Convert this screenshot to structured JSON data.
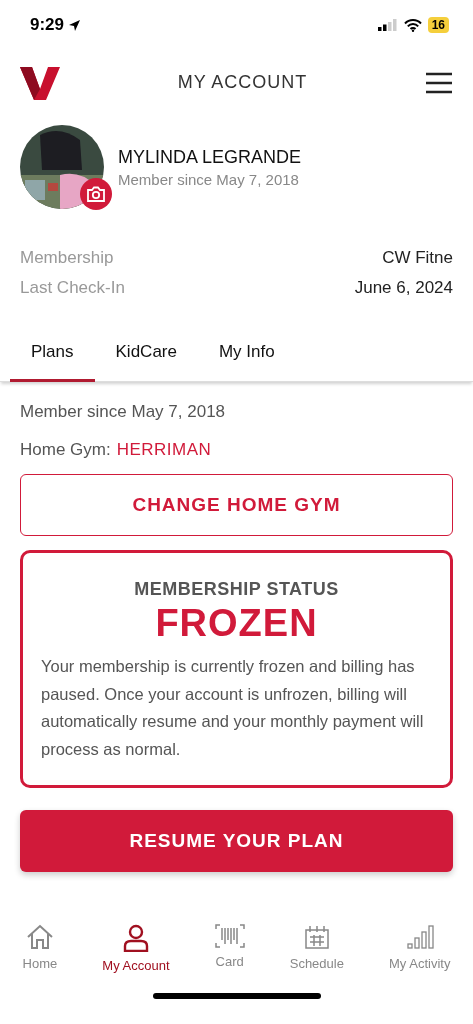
{
  "status_bar": {
    "time": "9:29",
    "battery": "16"
  },
  "header": {
    "title": "MY ACCOUNT"
  },
  "profile": {
    "name": "MYLINDA LEGRANDE",
    "subtitle": "Member since May 7, 2018"
  },
  "details": [
    {
      "label": "Membership",
      "value": "CW Fitne"
    },
    {
      "label": "Last Check-In",
      "value": "June 6, 2024"
    }
  ],
  "tabs": [
    {
      "label": "Plans",
      "selected": true
    },
    {
      "label": "KidCare",
      "selected": false
    },
    {
      "label": "My Info",
      "selected": false
    }
  ],
  "plan": {
    "member_since": "Member since May 7, 2018",
    "home_gym_label": "Home Gym:",
    "home_gym": "HERRIMAN",
    "change_button": "CHANGE HOME GYM",
    "status_heading": "MEMBERSHIP STATUS",
    "status": "FROZEN",
    "message": "Your membership is currently frozen and billing has paused. Once your account is unfrozen, billing will automatically resume and your monthly payment will process as normal.",
    "resume_button": "RESUME YOUR PLAN"
  },
  "nav": [
    {
      "kind": "home",
      "label": "Home",
      "selected": false
    },
    {
      "kind": "account",
      "label": "My Account",
      "selected": true
    },
    {
      "kind": "card",
      "label": "Card",
      "selected": false
    },
    {
      "kind": "schedule",
      "label": "Schedule",
      "selected": false
    },
    {
      "kind": "activity",
      "label": "My Activity",
      "selected": false
    }
  ]
}
